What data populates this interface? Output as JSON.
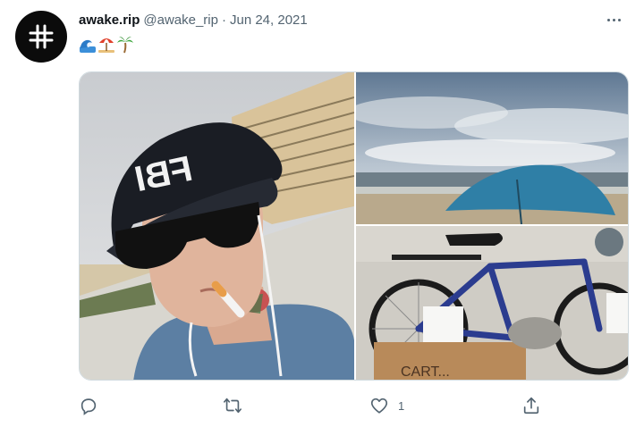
{
  "tweet": {
    "display_name": "awake.rip",
    "handle": "@awake_rip",
    "separator": "·",
    "date": "Jun 24, 2021",
    "emojis": [
      "wave-emoji",
      "beach-umbrella-emoji",
      "palm-tree-emoji"
    ]
  },
  "media": {
    "photos": [
      {
        "name": "selfie-photo",
        "cap_text": "FBI"
      },
      {
        "name": "beach-umbrella-photo"
      },
      {
        "name": "bicycle-photo",
        "sign_text": "CART..."
      }
    ]
  },
  "actions": {
    "reply_count": "",
    "retweet_count": "",
    "like_count": "1",
    "share_label": ""
  },
  "colors": {
    "text_primary": "#0f1419",
    "text_secondary": "#536471",
    "border": "#cfd9de"
  }
}
